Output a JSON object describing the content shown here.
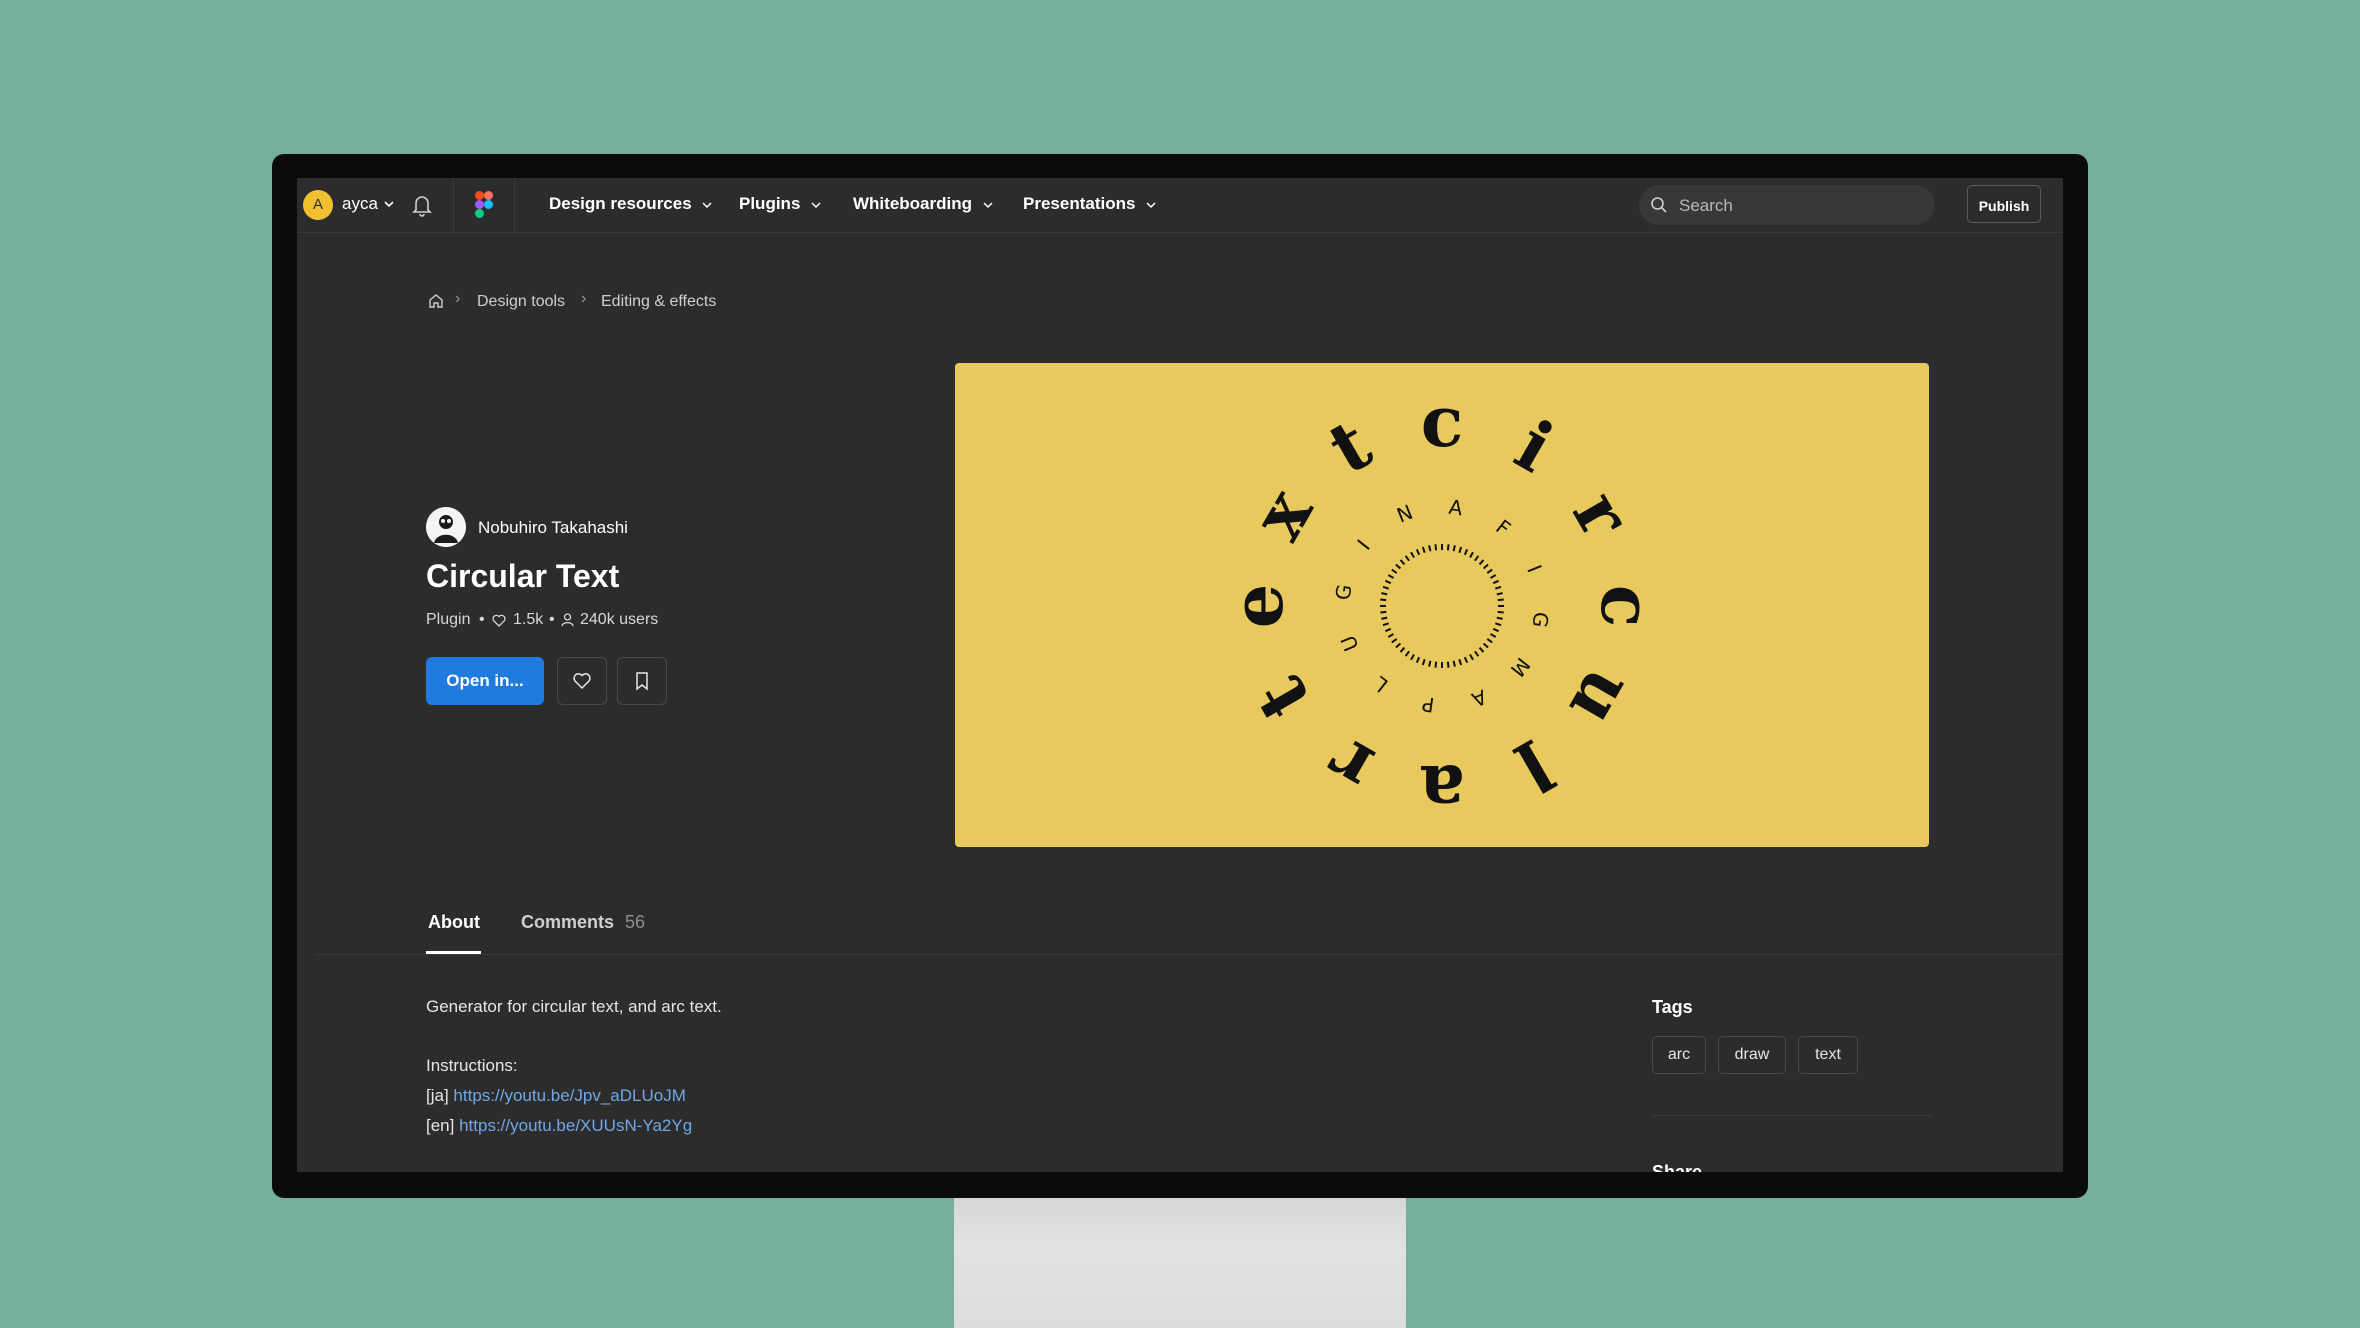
{
  "topnav": {
    "avatar_letter": "A",
    "username": "ayca",
    "menu": [
      {
        "label": "Design resources"
      },
      {
        "label": "Plugins"
      },
      {
        "label": "Whiteboarding"
      },
      {
        "label": "Presentations"
      }
    ],
    "search_placeholder": "Search",
    "publish_label": "Publish"
  },
  "breadcrumb": [
    "Design tools",
    "Editing & effects"
  ],
  "plugin": {
    "author": "Nobuhiro Takahashi",
    "title": "Circular Text",
    "type": "Plugin",
    "likes": "1.5k",
    "users": "240k users",
    "open_label": "Open in..."
  },
  "hero": {
    "outer_letters": "t c i r c u l a r t e x",
    "inner_letters": "F I G M A P L U G I N A",
    "background": "#e8c95e"
  },
  "tabs": [
    {
      "label": "About"
    },
    {
      "label": "Comments",
      "count": "56"
    }
  ],
  "about": {
    "description": "Generator for circular text, and arc text.",
    "instructions_label": "Instructions:",
    "links": [
      {
        "prefix": "[ja]",
        "url": "https://youtu.be/Jpv_aDLUoJM"
      },
      {
        "prefix": "[en]",
        "url": "https://youtu.be/XUUsN-Ya2Yg"
      }
    ]
  },
  "sidebar": {
    "tags_title": "Tags",
    "tags": [
      "arc",
      "draw",
      "text"
    ],
    "share_title": "Share"
  },
  "colors": {
    "accent": "#1f7be0",
    "link": "#6fa8e8",
    "screen_bg": "#2c2c2c",
    "desk_bg": "#76ae9b"
  }
}
